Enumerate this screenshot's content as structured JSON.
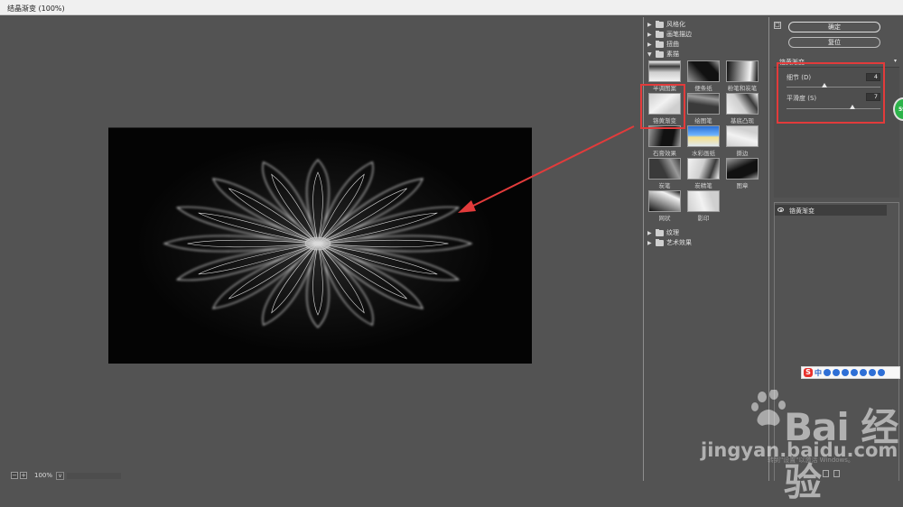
{
  "window": {
    "title": "结晶渐变 (100%)"
  },
  "status": {
    "zoom": "100%",
    "zoom_out": "−",
    "zoom_in": "+",
    "dropdown": "v"
  },
  "gallery": {
    "categories": [
      {
        "label": "风格化",
        "expanded": false
      },
      {
        "label": "画笔描边",
        "expanded": false
      },
      {
        "label": "扭曲",
        "expanded": false
      },
      {
        "label": "素描",
        "expanded": true
      },
      {
        "label": "纹理",
        "expanded": false
      },
      {
        "label": "艺术效果",
        "expanded": false
      }
    ],
    "sketch_filters": [
      "半调图案",
      "便条纸",
      "粉笔和炭笔",
      "铬黄渐变",
      "绘图笔",
      "基底凸现",
      "石膏效果",
      "水彩画纸",
      "撕边",
      "炭笔",
      "炭精笔",
      "图章",
      "网状",
      "影印"
    ],
    "selected": "铬黄渐变"
  },
  "panel": {
    "toggle_icon": "□",
    "ok_label": "确定",
    "reset_label": "复位",
    "filter_select": "铬黄渐变",
    "detail_label": "细节 (D)",
    "detail_value": "4",
    "detail_fraction": 0.4,
    "smooth_label": "平滑度 (S)",
    "smooth_value": "7",
    "smooth_fraction": 0.7,
    "layer_name": "铬黄渐变"
  },
  "overlay": {
    "green_bubble": "59",
    "ime_s": "S",
    "ime_zh": "中",
    "watermark_brand": "Bai 经验",
    "watermark_url": "jingyan.baidu.com",
    "activate_text": "转到\"设置\"以激活 Windows。"
  }
}
